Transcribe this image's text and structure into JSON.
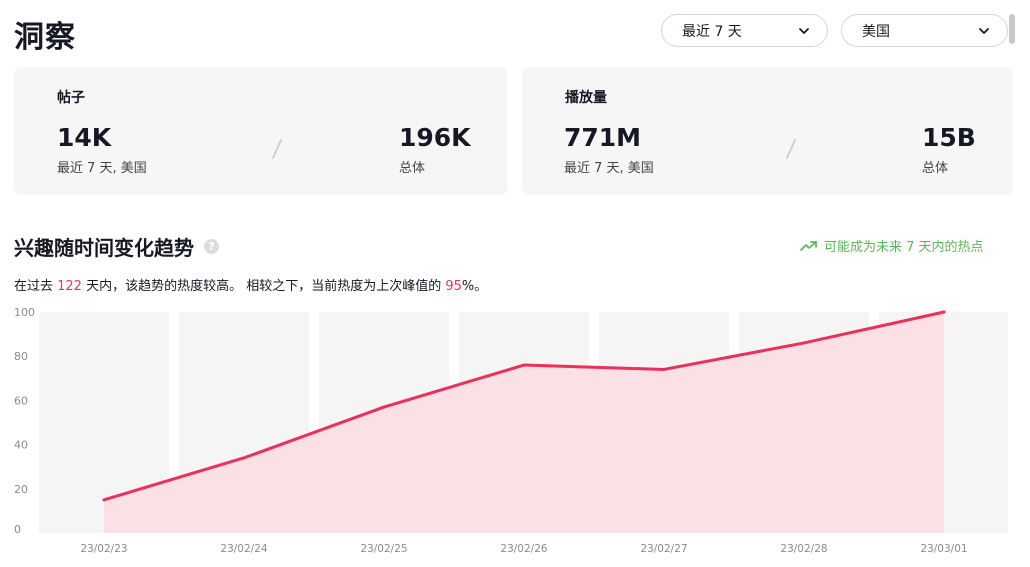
{
  "header": {
    "title": "洞察",
    "range_dropdown": "最近 7 天",
    "region_dropdown": "美国"
  },
  "cards": {
    "posts": {
      "title": "帖子",
      "recent_value": "14K",
      "recent_label": "最近 7 天, 美国",
      "total_value": "196K",
      "total_label": "总体"
    },
    "views": {
      "title": "播放量",
      "recent_value": "771M",
      "recent_label": "最近 7 天, 美国",
      "total_value": "15B",
      "total_label": "总体"
    }
  },
  "trend": {
    "title": "兴趣随时间变化趋势",
    "info_icon": "?",
    "hot_tag": "可能成为未来 7 天内的热点",
    "desc_prefix": "在过去 ",
    "desc_days": "122",
    "desc_mid": " 天内，该趋势的热度较高。 相较之下，当前热度为上次峰值的 ",
    "desc_pct": "95",
    "desc_suffix": "%。"
  },
  "colors": {
    "line": "#ee2f5a",
    "area": "#fbe0e6",
    "band": "#f5f5f6",
    "hot": "#5cb85c",
    "highlight": "#fe2c55"
  },
  "chart_data": {
    "type": "area",
    "categories": [
      "23/02/23",
      "23/02/24",
      "23/02/25",
      "23/02/26",
      "23/02/27",
      "23/02/28",
      "23/03/01"
    ],
    "values": [
      15,
      34,
      57,
      76,
      74,
      86,
      100
    ],
    "yticks": [
      0,
      20,
      40,
      60,
      80,
      100
    ],
    "ylim": [
      0,
      100
    ],
    "title": "",
    "xlabel": "",
    "ylabel": "",
    "grid": false,
    "legend": "none"
  }
}
